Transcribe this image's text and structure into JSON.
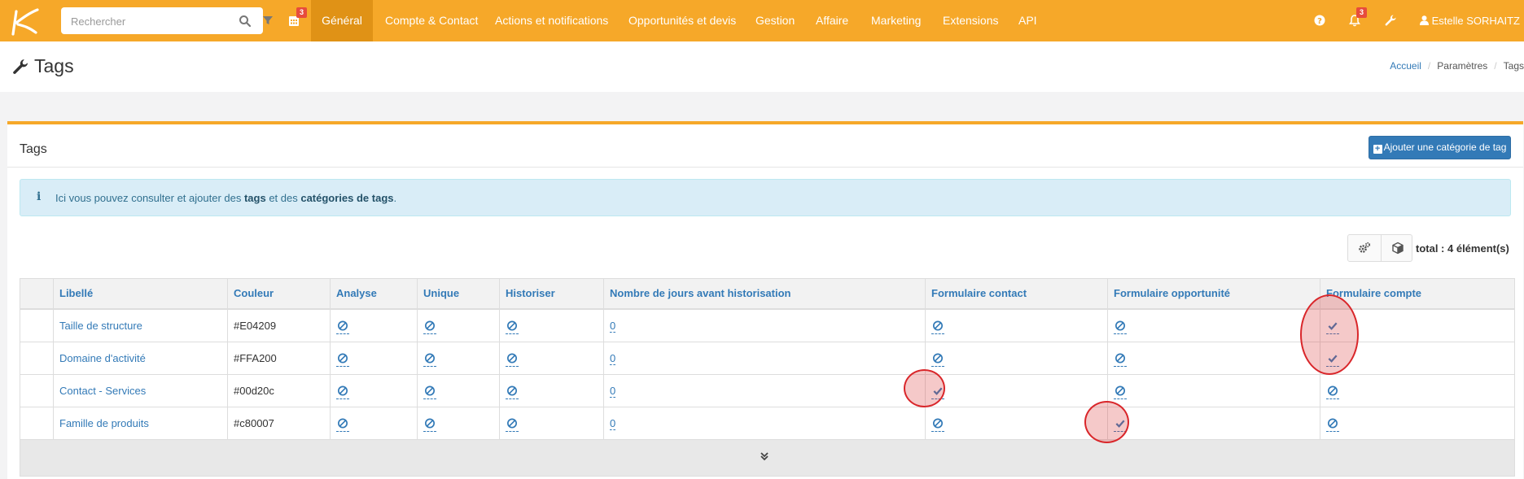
{
  "topbar": {
    "search_placeholder": "Rechercher",
    "calendar_badge": "3",
    "nav": [
      {
        "label": "Général",
        "active": true
      },
      {
        "label": "Compte & Contact"
      },
      {
        "label": "Actions et notifications"
      },
      {
        "label": "Opportunités et devis"
      },
      {
        "label": "Gestion"
      },
      {
        "label": "Affaire"
      },
      {
        "label": "Marketing"
      },
      {
        "label": "Extensions"
      },
      {
        "label": "API"
      }
    ],
    "notifications_badge": "3",
    "user_name": "Estelle SORHAITZ"
  },
  "page": {
    "title": "Tags",
    "breadcrumb": [
      "Accueil",
      "Paramètres",
      "Tags"
    ]
  },
  "box": {
    "title": "Tags",
    "add_button": "Ajouter une catégorie de tag",
    "info": {
      "part1": "Ici vous pouvez consulter et ajouter des ",
      "bold1": "tags",
      "part2": " et des ",
      "bold2": "catégories de tags",
      "part3": "."
    },
    "total": "total : 4 élément(s)"
  },
  "table": {
    "headers": [
      "Libellé",
      "Couleur",
      "Analyse",
      "Unique",
      "Historiser",
      "Nombre de jours avant historisation",
      "Formulaire contact",
      "Formulaire opportunité",
      "Formulaire compte"
    ],
    "rows": [
      {
        "label": "Taille de structure",
        "color": "#E04209",
        "analyse": "ban",
        "unique": "ban",
        "historiser": "ban",
        "jours": "0",
        "contact": "ban",
        "opportunite": "ban",
        "compte": "check"
      },
      {
        "label": "Domaine d'activité",
        "color": "#FFA200",
        "analyse": "ban",
        "unique": "ban",
        "historiser": "ban",
        "jours": "0",
        "contact": "ban",
        "opportunite": "ban",
        "compte": "check"
      },
      {
        "label": "Contact - Services",
        "color": "#00d20c",
        "analyse": "ban",
        "unique": "ban",
        "historiser": "ban",
        "jours": "0",
        "contact": "check",
        "opportunite": "ban",
        "compte": "ban"
      },
      {
        "label": "Famille de produits",
        "color": "#c80007",
        "analyse": "ban",
        "unique": "ban",
        "historiser": "ban",
        "jours": "0",
        "contact": "ban",
        "opportunite": "check",
        "compte": "ban"
      }
    ]
  },
  "colors": {
    "accent": "#f6a829",
    "accent_active": "#e09216",
    "link": "#337ab7",
    "annotation": "#d9262a"
  }
}
